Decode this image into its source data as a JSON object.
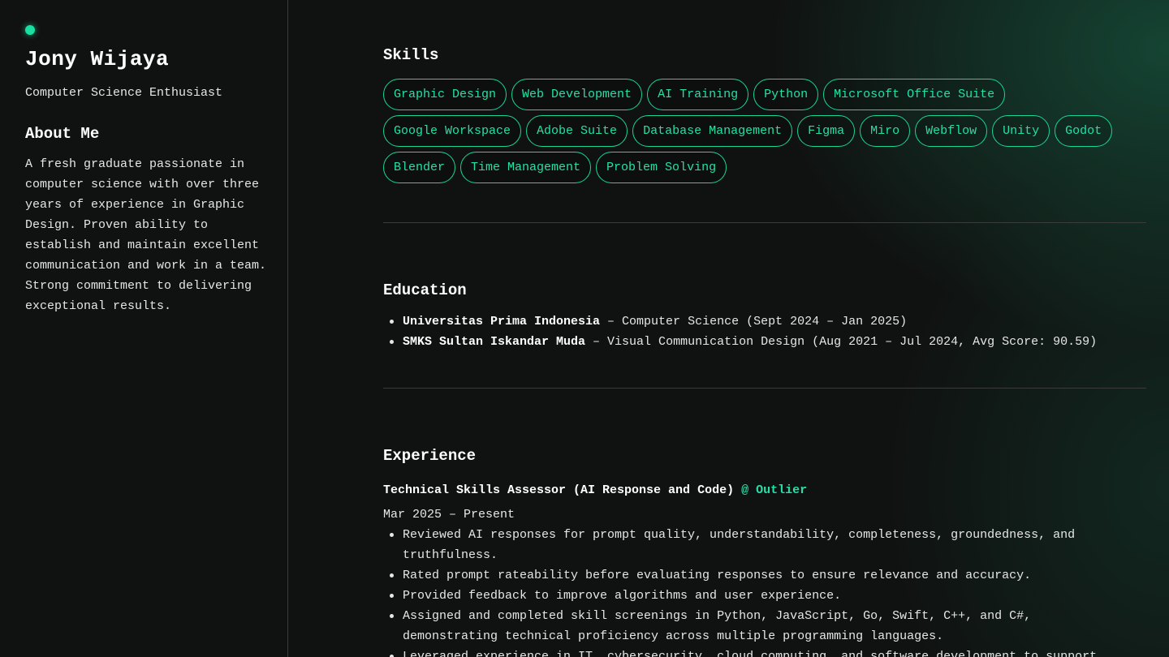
{
  "sidebar": {
    "name": "Jony Wijaya",
    "tagline": "Computer Science Enthusiast",
    "about_title": "About Me",
    "about_text": "A fresh graduate passionate in computer science with over three years of experience in Graphic Design. Proven ability to establish and maintain excellent communication and work in a team. Strong commitment to delivering exceptional results."
  },
  "skills": {
    "title": "Skills",
    "items": [
      "Graphic Design",
      "Web Development",
      "AI Training",
      "Python",
      "Microsoft Office Suite",
      "Google Workspace",
      "Adobe Suite",
      "Database Management",
      "Figma",
      "Miro",
      "Webflow",
      "Unity",
      "Godot",
      "Blender",
      "Time Management",
      "Problem Solving"
    ]
  },
  "education": {
    "title": "Education",
    "items": [
      {
        "school": "Universitas Prima Indonesia",
        "details": " – Computer Science (Sept 2024 – Jan 2025)"
      },
      {
        "school": "SMKS Sultan Iskandar Muda",
        "details": " – Visual Communication Design (Aug 2021 – Jul 2024, Avg Score: 90.59)"
      }
    ]
  },
  "experience": {
    "title": "Experience",
    "jobs": [
      {
        "role": "Technical Skills Assessor (AI Response and Code)",
        "company": "@ Outlier",
        "dates": "Mar 2025 – Present",
        "bullets": [
          "Reviewed AI responses for prompt quality, understandability, completeness, groundedness, and truthfulness.",
          "Rated prompt rateability before evaluating responses to ensure relevance and accuracy.",
          "Provided feedback to improve algorithms and user experience.",
          "Assigned and completed skill screenings in Python, JavaScript, Go, Swift, C++, and C#, demonstrating technical proficiency across multiple programming languages.",
          "Leveraged experience in IT, cybersecurity, cloud computing, and software development to support"
        ]
      }
    ]
  },
  "colors": {
    "accent": "#24e0a6",
    "background": "#101211"
  }
}
